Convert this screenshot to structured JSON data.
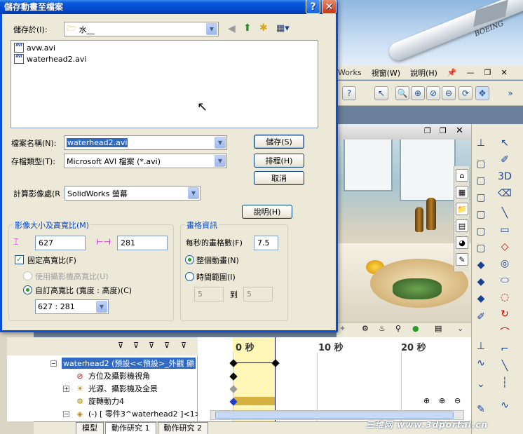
{
  "dialog": {
    "title": "儲存動畫至檔案",
    "help_button": "?",
    "close_button": "✕",
    "save_in_label": "儲存於(I):",
    "save_in_value": "水__",
    "files": [
      "avw.avi",
      "waterhead2.avi"
    ],
    "filename_label": "檔案名稱(N):",
    "filename_value": "waterhead2.avi",
    "filetype_label": "存檔類型(T):",
    "filetype_value": "Microsoft AVI 檔案 (*.avi)",
    "renderer_label": "計算影像處(R",
    "renderer_value": "SolidWorks 螢幕",
    "buttons": {
      "save": "儲存(S)",
      "schedule": "排程(H)",
      "cancel": "取消",
      "help": "說明(H)"
    },
    "image_group": {
      "title": "影像大小及高寬比(M)",
      "width": "627",
      "height": "281",
      "fixed_aspect_label": "固定高寬比(F)",
      "fixed_aspect_checked": true,
      "camera_aspect_label": "使用攝影機高寬比(U)",
      "custom_aspect_label": "自訂高寬比 (寬度 : 高度)(C)",
      "custom_aspect_value": "627 : 281"
    },
    "frame_group": {
      "title": "畫格資訊",
      "fps_label": "每秒的畫格數(F)",
      "fps_value": "7.5",
      "entire_label": "整個動畫(N)",
      "range_label": "時間範圍(I)",
      "range_from": "5",
      "range_to_label": "到",
      "range_to": "5"
    }
  },
  "solidworks": {
    "menu": [
      "Works",
      "視窗(W)",
      "說明(H)"
    ],
    "brand": "BOEING",
    "motion_tree": [
      "waterhead2 (預設<<預設>_外觀 顯",
      "方位及攝影機視角",
      "光源、攝影機及全景",
      "旋轉動力4",
      "(-) [ 零件3^waterhead2 ]<1> (預"
    ],
    "timeline_labels": [
      "0 秒",
      "10 秒",
      "20 秒"
    ],
    "tabs": [
      "模型",
      "動作研究 1",
      "動作研究 2"
    ],
    "watermark": "三维网 www.3dportal.cn"
  },
  "colors": {
    "title_bar": "#0045c8",
    "selection": "#316ac5",
    "dialog_bg": "#ece9d8",
    "group_title": "#0046d5",
    "timeline_bar": "#d4b140"
  }
}
